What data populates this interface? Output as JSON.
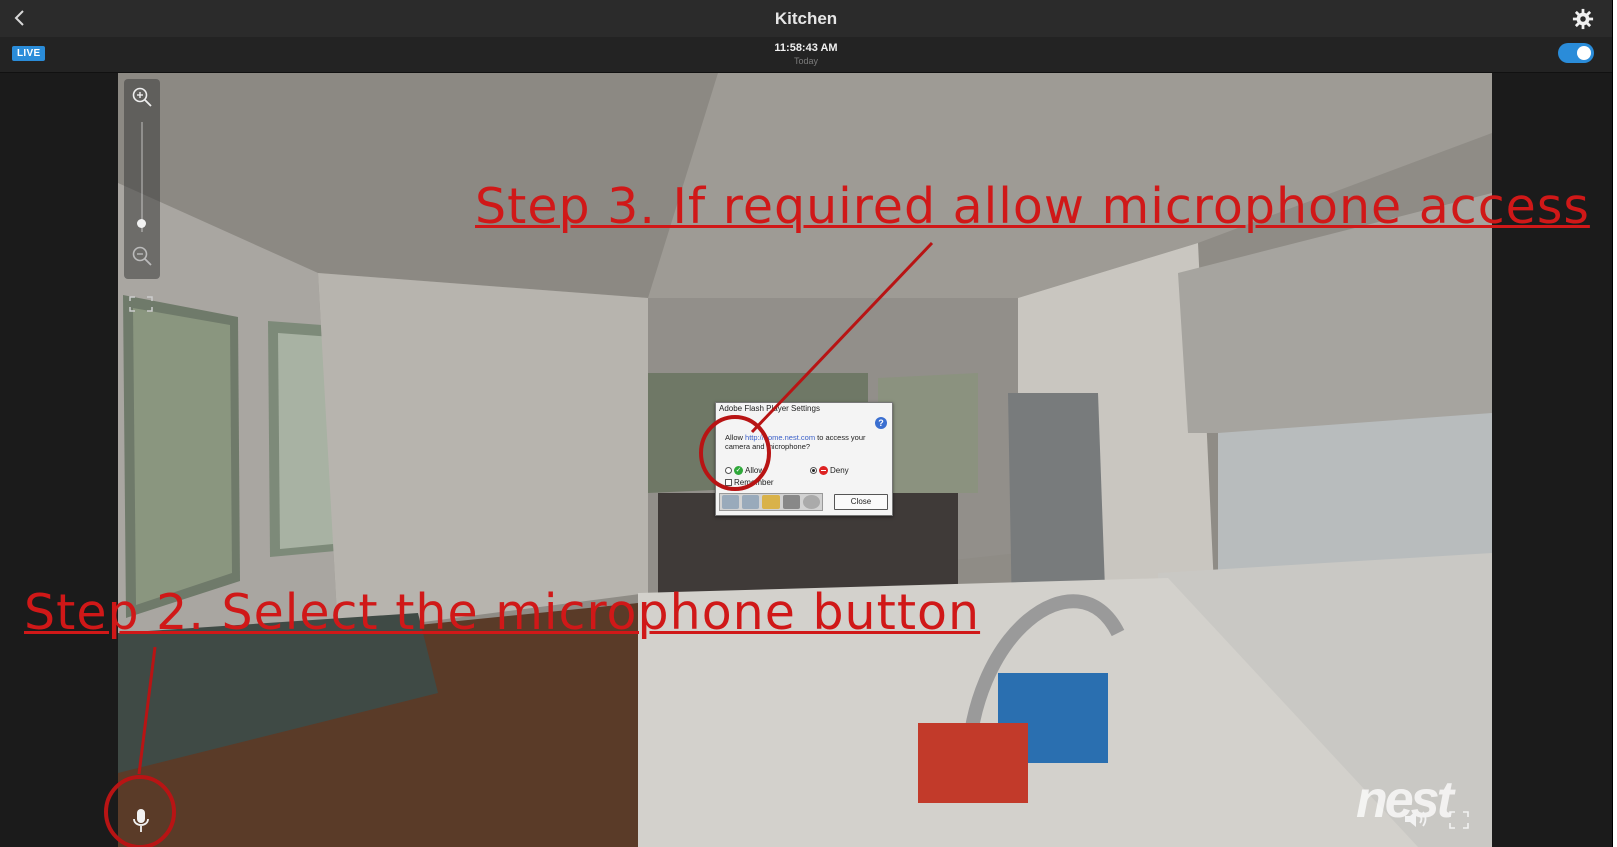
{
  "header": {
    "back_icon": "chevron-left-icon",
    "title": "Kitchen",
    "settings_icon": "gear-icon"
  },
  "status_bar": {
    "live_label": "LIVE",
    "time": "11:58:43 AM",
    "day": "Today",
    "camera_on": true
  },
  "colors": {
    "accent": "#2a8cd9",
    "annotation": "#d01818",
    "toolbar": "#2b2b2b"
  },
  "zoom": {
    "zoom_in_icon": "zoom-in-icon",
    "zoom_out_icon": "zoom-out-icon",
    "level": 0.1
  },
  "flash_dialog": {
    "title": "Adobe Flash Player Settings",
    "message_prefix": "Allow",
    "message_link": "http://home.nest.com",
    "message_suffix": "to access your camera and microphone?",
    "allow_label": "Allow",
    "deny_label": "Deny",
    "remember_label": "Remember",
    "close_label": "Close",
    "selected": "Deny"
  },
  "controls": {
    "mic_icon": "microphone-icon",
    "volume_icon": "volume-icon",
    "fullscreen_icon": "fullscreen-icon",
    "logo": "nest"
  },
  "annotations": {
    "step3": "Step 3. If required allow microphone access",
    "step2": "Step 2. Select the microphone button"
  }
}
